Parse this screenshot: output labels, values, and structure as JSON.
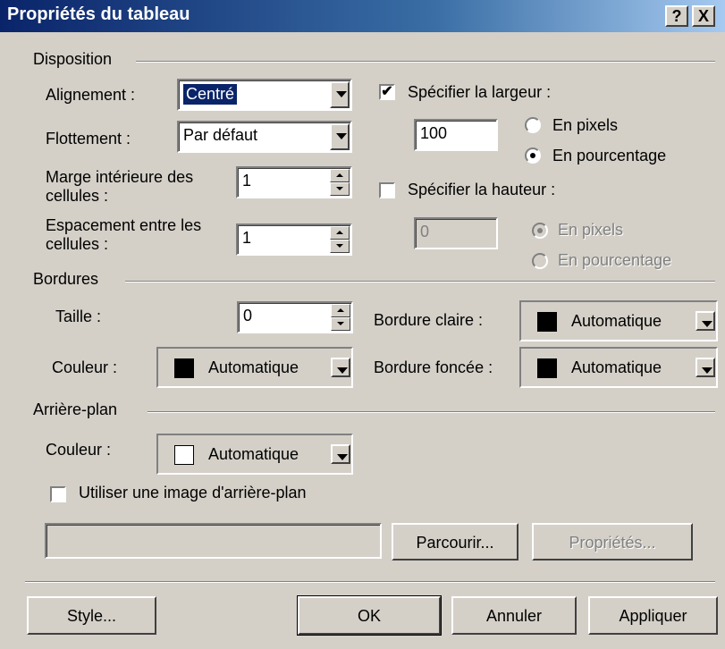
{
  "window": {
    "title": "Propriétés du tableau",
    "help_glyph": "?",
    "close_glyph": "X"
  },
  "disposition": {
    "label": "Disposition",
    "alignement_label": "Alignement :",
    "alignement_value": "Centré",
    "flottement_label": "Flottement :",
    "flottement_value": "Par défaut",
    "marge_label_1": "Marge intérieure des",
    "marge_label_2": "cellules :",
    "marge_value": "1",
    "espacement_label_1": "Espacement entre les",
    "espacement_label_2": "cellules :",
    "espacement_value": "1",
    "largeur_label": "Spécifier la largeur :",
    "largeur_checked": true,
    "largeur_value": "100",
    "largeur_pixels": "En pixels",
    "largeur_pourcentage": "En pourcentage",
    "hauteur_label": "Spécifier la hauteur :",
    "hauteur_checked": false,
    "hauteur_value": "0",
    "hauteur_pixels": "En pixels",
    "hauteur_pourcentage": "En pourcentage"
  },
  "bordures": {
    "label": "Bordures",
    "taille_label": "Taille :",
    "taille_value": "0",
    "couleur_label": "Couleur :",
    "couleur_value": "Automatique",
    "couleur_swatch": "#000000",
    "claire_label": "Bordure claire :",
    "claire_value": "Automatique",
    "claire_swatch": "#000000",
    "foncee_label": "Bordure foncée :",
    "foncee_value": "Automatique",
    "foncee_swatch": "#000000"
  },
  "arriere_plan": {
    "label": "Arrière-plan",
    "couleur_label": "Couleur :",
    "couleur_value": "Automatique",
    "couleur_swatch": "#ffffff",
    "image_label": "Utiliser une image d'arrière-plan",
    "image_checked": false,
    "image_path": "",
    "parcourir_label": "Parcourir...",
    "proprietes_label": "Propriétés..."
  },
  "footer": {
    "style_label": "Style...",
    "ok_label": "OK",
    "annuler_label": "Annuler",
    "appliquer_label": "Appliquer"
  }
}
